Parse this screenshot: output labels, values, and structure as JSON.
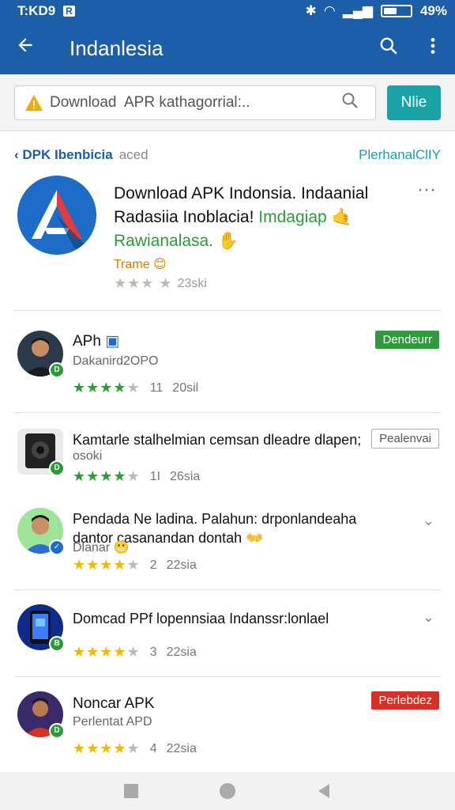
{
  "status": {
    "time": "T:KD9",
    "r_badge": "R",
    "battery": "49%"
  },
  "appbar": {
    "title": "Indanlesia",
    "back_icon": "arrow-left-icon",
    "search_icon": "search-icon",
    "menu_icon": "more-vert-icon"
  },
  "search": {
    "value": "Download  APR kathagorrial:..",
    "button": "Nlie"
  },
  "breadcrumb": {
    "link": "DPK Ibenbicia",
    "extra": "aced",
    "right": "PlerhanalClIY"
  },
  "featured": {
    "line1": "Download APK Indonsia. Indaanial",
    "line2a": "Radasiia Inoblacia!",
    "line2b": "Imdagiap",
    "line3": "Rawianalasa.",
    "tag": "Trame",
    "rating_count": "23ski",
    "more": "···"
  },
  "items": [
    {
      "title": "APh",
      "subtitle": "Dakanird2OPO",
      "stars": 4,
      "count": "11",
      "date": "20sil",
      "pill": "Dendeurr",
      "pill_style": "green"
    },
    {
      "title": "Kamtarle stalhelmian cemsan dleadre dlapen;",
      "subtitle": "osoki",
      "stars": 4,
      "count": "1I",
      "date": "26sia",
      "pill": "Pealenvai",
      "pill_style": "outline"
    },
    {
      "title": "Pendada Ne ladina. Palahun: drponlandeaha",
      "title2": "dantor casanandan dontah",
      "subtitle": "Dlanar",
      "stars": 4,
      "count": "2",
      "date": "22sia",
      "chevron": "⌄"
    },
    {
      "title": "Domcad PPf lopennsiaa Indanssr:lonlael",
      "stars": 4,
      "count": "3",
      "date": "22sia",
      "chevron": "⌄"
    },
    {
      "title": "Noncar APK",
      "subtitle": "Perlentat APD",
      "stars": 4,
      "count": "4",
      "date": "22sia",
      "pill": "Perlebdez",
      "pill_style": "red"
    }
  ],
  "colors": {
    "primary": "#1d5ea8",
    "teal": "#1ba2a6",
    "green": "#2e9b3a",
    "red": "#d93025",
    "star_yellow": "#f2b705"
  }
}
